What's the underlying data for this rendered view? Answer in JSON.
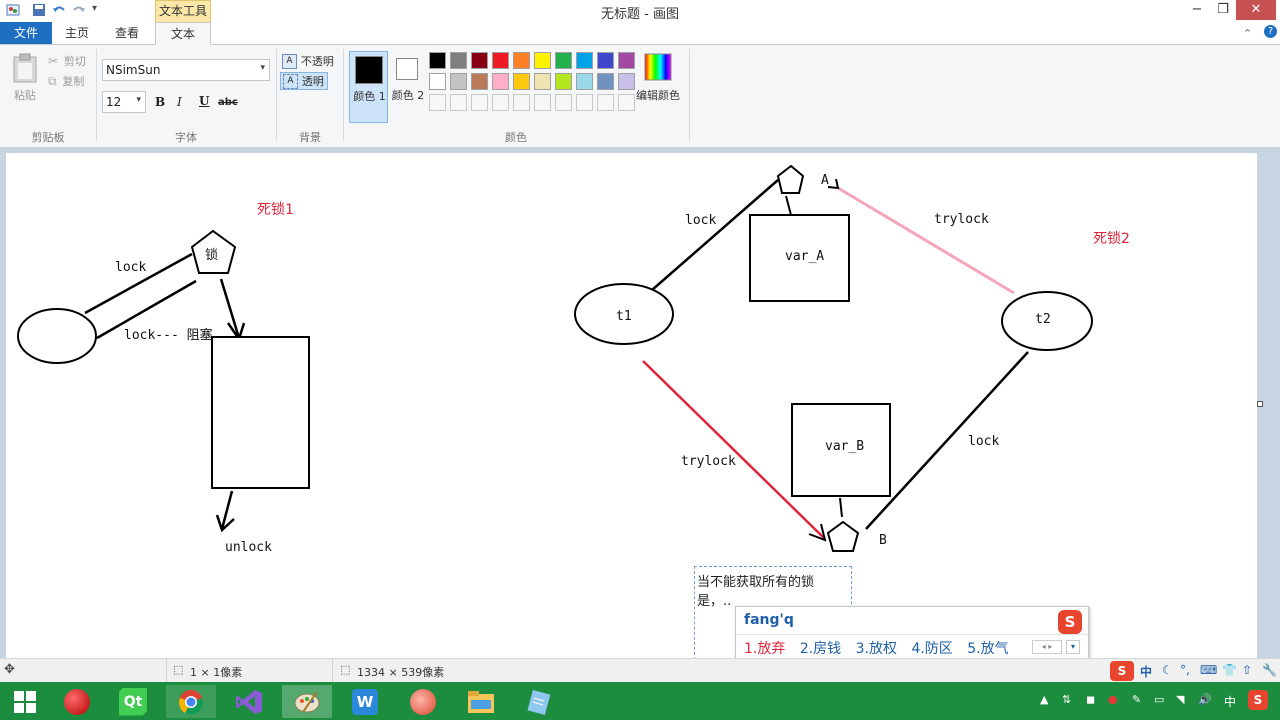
{
  "window": {
    "title": "无标题 - 画图",
    "context_tab": "文本工具",
    "minimize": "−",
    "maximize": "❐",
    "close": "✕"
  },
  "tabs": {
    "file": "文件",
    "home": "主页",
    "view": "查看",
    "text": "文本"
  },
  "help_icon": "?",
  "clipboard": {
    "paste": "粘贴",
    "cut": "剪切",
    "copy": "复制",
    "group": "剪贴板"
  },
  "font": {
    "family": "NSimSun",
    "size": "12",
    "bold": "B",
    "italic": "I",
    "underline": "U",
    "strike": "abc",
    "group": "字体"
  },
  "background": {
    "opaque": "不透明",
    "transparent": "透明",
    "group": "背景"
  },
  "colors": {
    "color1": "颜色 1",
    "color2": "颜色 2",
    "edit": "编辑颜色",
    "group": "颜色",
    "color1_value": "#000000",
    "color2_value": "#ffffff",
    "palette_row1": [
      "#000000",
      "#7f7f7f",
      "#880015",
      "#ed1c24",
      "#ff7f27",
      "#fff200",
      "#22b14c",
      "#00a2e8",
      "#3f48cc",
      "#a349a4"
    ],
    "palette_row2": [
      "#ffffff",
      "#c3c3c3",
      "#b97a57",
      "#ffaec9",
      "#ffc90e",
      "#efe4b0",
      "#b5e61d",
      "#99d9ea",
      "#7092be",
      "#c8bfe7"
    ]
  },
  "canvas": {
    "labels": {
      "deadlock1": "死锁1",
      "deadlock2": "死锁2",
      "lock_char": "锁",
      "lock1": "lock",
      "lock_blocked": "lock--- 阻塞",
      "unlock": "unlock",
      "lock_t1": "lock",
      "trylock_t2": "trylock",
      "t1": "t1",
      "t2": "t2",
      "var_a": "var_A",
      "var_b": "var_B",
      "a": "A",
      "b": "B",
      "trylock_t1": "trylock",
      "lock_t2": "lock"
    },
    "text_box": {
      "line1": "当不能获取所有的锁",
      "line2": "是，.."
    }
  },
  "ime": {
    "input": "fang'q",
    "candidates": [
      "1.放弃",
      "2.房钱",
      "3.放权",
      "4.防区",
      "5.放气"
    ]
  },
  "status": {
    "selection": "1 × 1像素",
    "canvas_size": "1334 × 539像素"
  },
  "taskbar": {
    "icons": [
      "start-icon",
      "record-icon",
      "qt-icon",
      "chrome-icon",
      "visual-studio-icon",
      "paint-icon",
      "wps-icon",
      "app-icon",
      "file-explorer-icon",
      "notepad-icon"
    ],
    "tray_lang": "中"
  }
}
